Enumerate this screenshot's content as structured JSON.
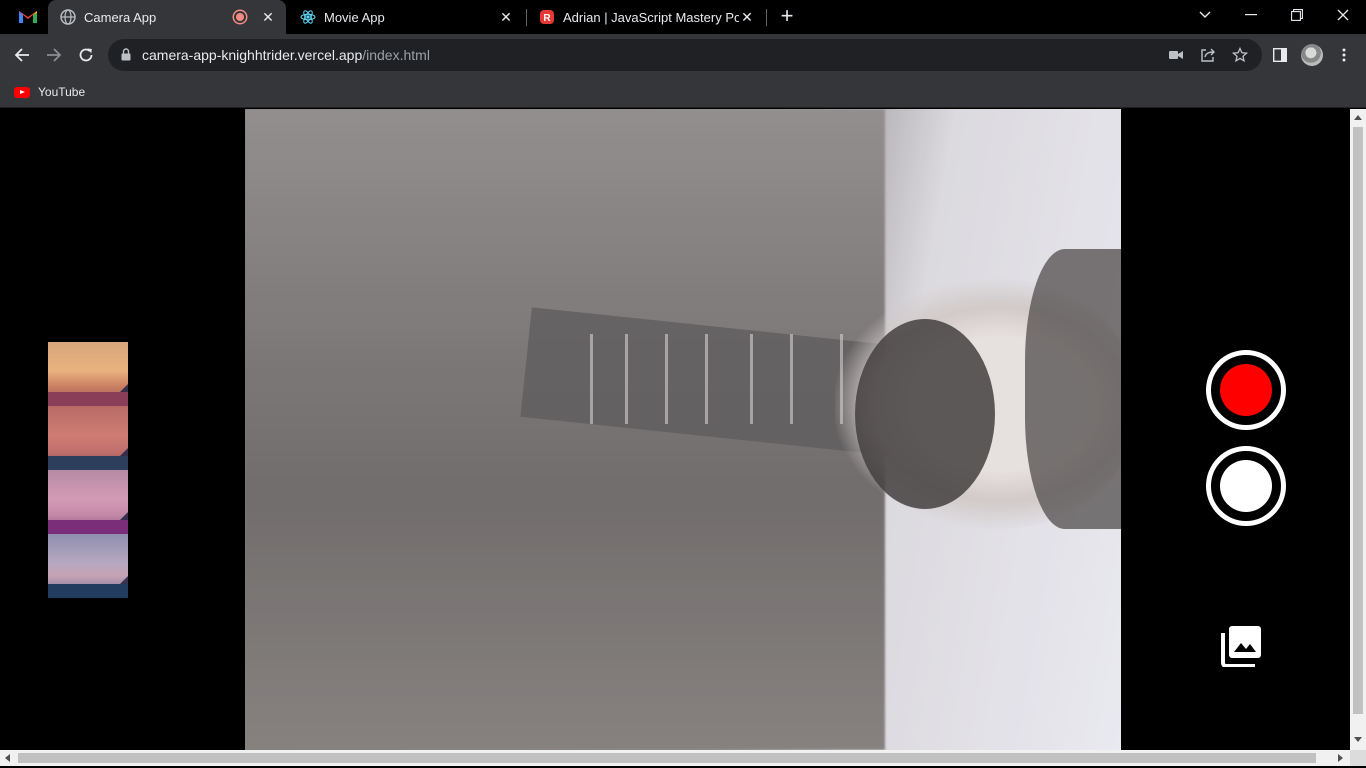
{
  "browser": {
    "tabs": [
      {
        "title": "Camera App",
        "favicon": "globe-icon",
        "recording": true,
        "active": true
      },
      {
        "title": "Movie App",
        "favicon": "react-icon",
        "active": false
      },
      {
        "title": "Adrian | JavaScript Mastery Portfo",
        "favicon": "portfolio-icon",
        "active": false
      }
    ],
    "url_host": "camera-app-knighhtrider.vercel.app",
    "url_path": "/index.html",
    "bookmarks": [
      {
        "label": "YouTube",
        "icon": "youtube-icon"
      }
    ]
  },
  "camera_app": {
    "filters": [
      {
        "name": "filter-orange",
        "tint": "#e79a62"
      },
      {
        "name": "filter-red",
        "tint": "#c9605e"
      },
      {
        "name": "filter-pink",
        "tint": "#d17fa8"
      },
      {
        "name": "filter-blue",
        "tint": "#8ea0c9"
      }
    ],
    "record_button": {
      "icon": "record-icon",
      "color": "#ff0000"
    },
    "capture_button": {
      "icon": "capture-icon",
      "color": "#ffffff"
    },
    "gallery_button": {
      "icon": "gallery-icon"
    }
  },
  "colors": {
    "tab_active_bg": "#35363a",
    "omnibox_bg": "#202124",
    "page_bg": "#000000"
  }
}
